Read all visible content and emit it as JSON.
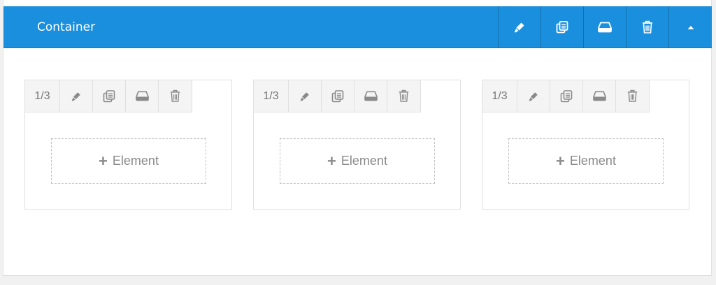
{
  "container": {
    "title": "Container",
    "accent_color": "#1a8fdd",
    "actions": [
      {
        "icon": "pencil-icon",
        "name": "edit-container-button"
      },
      {
        "icon": "copy-icon",
        "name": "clone-container-button"
      },
      {
        "icon": "save-icon",
        "name": "save-container-button"
      },
      {
        "icon": "trash-icon",
        "name": "delete-container-button"
      },
      {
        "icon": "caret-up-icon",
        "name": "collapse-container-button"
      }
    ]
  },
  "columns": [
    {
      "size_label": "1/3",
      "add_label": "Element",
      "add_icon": "plus-icon"
    },
    {
      "size_label": "1/3",
      "add_label": "Element",
      "add_icon": "plus-icon"
    },
    {
      "size_label": "1/3",
      "add_label": "Element",
      "add_icon": "plus-icon"
    }
  ],
  "column_tools": [
    "pencil-icon",
    "copy-icon",
    "save-icon",
    "trash-icon"
  ]
}
